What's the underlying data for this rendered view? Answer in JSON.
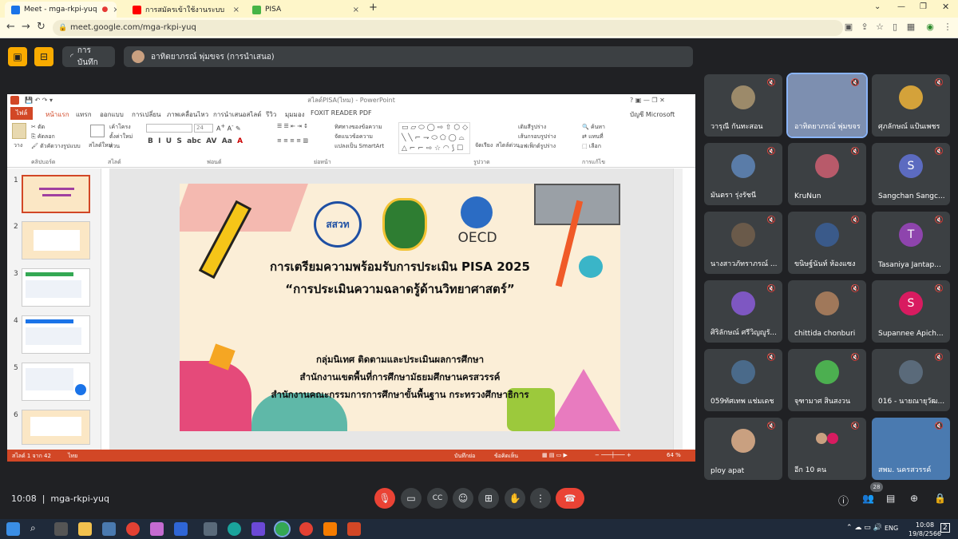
{
  "browser": {
    "tabs": [
      {
        "label": "Meet - mga-rkpi-yuq",
        "active": true,
        "fav": "#1a73e8"
      },
      {
        "label": "การสมัครเข้าใช้งานระบบ PISA STYLE",
        "active": false,
        "fav": "#ff0000"
      },
      {
        "label": "PISA",
        "active": false,
        "fav": "#46b446"
      }
    ],
    "new_tab": "+",
    "url": "meet.google.com/mga-rkpi-yuq"
  },
  "meet": {
    "recording_label": "การบันทึก",
    "presenter_label": "อาทิตยาภรณ์ พุ่มขจร (การนำเสนอ)",
    "time": "10:08",
    "meeting_code": "mga-rkpi-yuq",
    "people_count": "28",
    "participants": [
      {
        "name": "วารุณี กันทะสอน",
        "avatar": "photo",
        "color": "#9c8a6a"
      },
      {
        "name": "อาทิตยาภรณ์ พุ่มขจร",
        "avatar": "video",
        "color": "#7d8fb0"
      },
      {
        "name": "ศุภลักษณ์ แป้นเพชร",
        "avatar": "photo",
        "color": "#d4a23a"
      },
      {
        "name": "มันตรา รุ่งรัชนี",
        "avatar": "photo",
        "color": "#5a7ca8"
      },
      {
        "name": "KruNun",
        "avatar": "photo",
        "color": "#b85a6a"
      },
      {
        "name": "Sangchan Sangc...",
        "avatar": "S",
        "color": "#5c6bc0"
      },
      {
        "name": "นางสาวภัทราภรณ์ ...",
        "avatar": "photo",
        "color": "#6a5a4a"
      },
      {
        "name": "ขนิษฐ์นันท์ ห้องแซง",
        "avatar": "photo",
        "color": "#3a5a8a"
      },
      {
        "name": "Tasaniya Jantap...",
        "avatar": "T",
        "color": "#8e44ad"
      },
      {
        "name": "ศิริลักษณ์ ศรีวิญญูรั...",
        "avatar": "person",
        "color": "#7e57c2"
      },
      {
        "name": "chittida chonburi",
        "avatar": "photo",
        "color": "#a0785a"
      },
      {
        "name": "Supannee Apich...",
        "avatar": "S",
        "color": "#d81b60"
      },
      {
        "name": "059ทัศเทพ แช่มเดช",
        "avatar": "photo",
        "color": "#4a6a8a"
      },
      {
        "name": "จุฑามาศ สินสงวน",
        "avatar": "photo",
        "color": "#4caf50"
      },
      {
        "name": "016 - นายณายุวัฒ...",
        "avatar": "photo",
        "color": "#5a6a7a"
      },
      {
        "name": "ploy apat",
        "avatar": "photo",
        "color": "#c9a080"
      },
      {
        "name": "อีก 10 คน",
        "avatar": "group",
        "color": "#888"
      },
      {
        "name": "สพม. นครสวรรค์",
        "avatar": "video",
        "color": "#4a7ab0"
      }
    ]
  },
  "ppt": {
    "title": "สไลด์PISA(ไทม) - PowerPoint",
    "file_tab": "ไฟล์",
    "tabs": [
      "หน้าแรก",
      "แทรก",
      "ออกแบบ",
      "การเปลี่ยน",
      "ภาพเคลื่อนไหว",
      "การนำเสนอสไลด์",
      "รีวิว",
      "มุมมอง",
      "FOXIT READER PDF"
    ],
    "account": "บัญชี Microsoft",
    "groups": [
      "คลิปบอร์ด",
      "สไลด์",
      "ฟอนต์",
      "ย่อหน้า",
      "รูปวาด",
      "การแก้ไข"
    ],
    "clipboard": [
      "ตัด",
      "คัดลอก",
      "ตัวคัดวางรูปแบบ",
      "วาง"
    ],
    "slides_group": [
      "เค้าโครง",
      "ตั้งค่าใหม่",
      "ส่วน",
      "สไลด์ใหม่"
    ],
    "font_size": "24",
    "paragraph": [
      "ทิศทางของข้อความ",
      "จัดแนวข้อความ",
      "แปลงเป็น SmartArt"
    ],
    "drawing": [
      "จัดเรียง",
      "สไตล์ด่วน",
      "เติมสีรูปร่าง",
      "เส้นกรอบรูปร่าง",
      "เอฟเฟ็กต์รูปร่าง"
    ],
    "editing": [
      "ค้นหา",
      "แทนที่",
      "เลือก"
    ],
    "slide_numbers": [
      "1",
      "2",
      "3",
      "4",
      "5",
      "6"
    ],
    "status_slide": "สไลด์ 1 จาก 42",
    "status_lang": "ไทย",
    "status_notes": "บันทึกย่อ",
    "status_comments": "ข้อคิดเห็น",
    "zoom": "64 %",
    "slide": {
      "logo1": "สสวท",
      "logo3": "OECD",
      "title1": "การเตรียมความพร้อมรับการประเมิน PISA 2025",
      "title2": "“การประเมินความฉลาดรู้ด้านวิทยาศาสตร์”",
      "org1": "กลุ่มนิเทศ ติดตามและประเมินผลการศึกษา",
      "org2": "สำนักงานเขตพื้นที่การศึกษามัธยมศึกษานครสวรรค์",
      "org3": "สำนักงานคณะกรรมการการศึกษาขั้นพื้นฐาน กระทรวงศึกษาธิการ"
    }
  },
  "taskbar": {
    "lang": "ENG",
    "time": "10:08",
    "date": "19/8/2566",
    "notif": "2"
  }
}
